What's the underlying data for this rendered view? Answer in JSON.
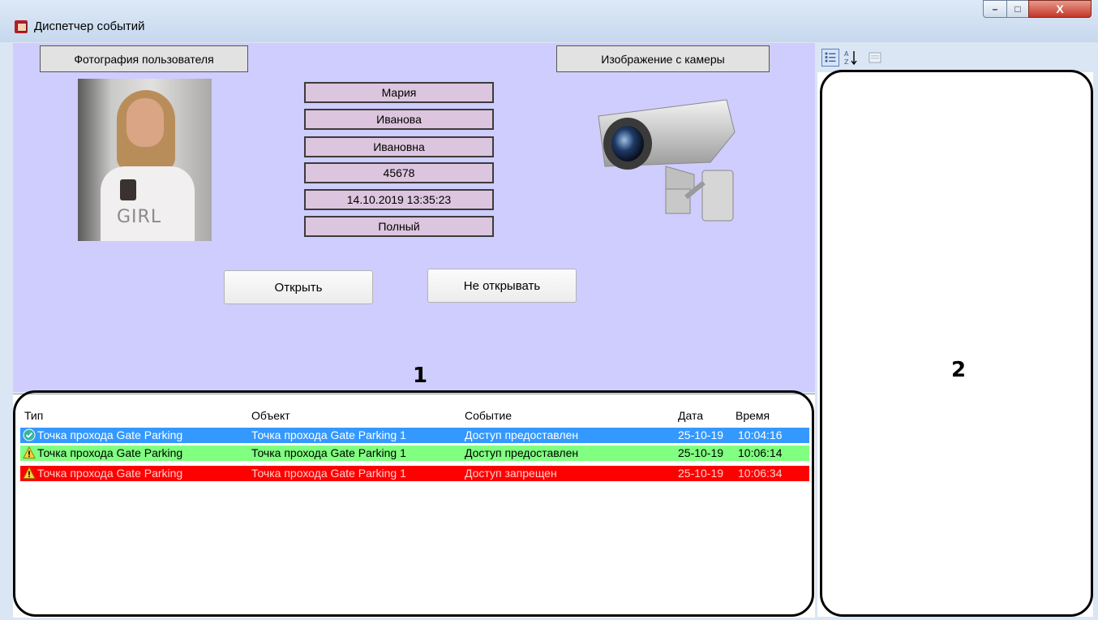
{
  "window": {
    "title": "Диспетчер событий",
    "buttons": {
      "minimize": "–",
      "maximize": "□",
      "close": "X"
    }
  },
  "panel": {
    "user_photo_label": "Фотография пользователя",
    "camera_label": "Изображение с камеры",
    "photo_caption": "GIRL",
    "fields": [
      "Мария",
      "Иванова",
      "Ивановна",
      "45678",
      "14.10.2019 13:35:23",
      "Полный"
    ],
    "open_button": "Открыть",
    "deny_button": "Не открывать"
  },
  "callouts": {
    "left": "1",
    "right": "2"
  },
  "events": {
    "columns": [
      "Тип",
      "Объект",
      "Событие",
      "Дата",
      "Время"
    ],
    "rows": [
      {
        "type": "Точка прохода Gate Parking",
        "object": "Точка прохода Gate Parking 1",
        "event": "Доступ предоставлен",
        "date": "25-10-19",
        "time": "10:04:16",
        "status_icon": "check-icon",
        "color": "#3399ff"
      },
      {
        "type": "Точка прохода Gate Parking",
        "object": "Точка прохода Gate Parking 1",
        "event": "Доступ предоставлен",
        "date": "25-10-19",
        "time": "10:06:14",
        "status_icon": "warning-icon",
        "color": "#80ff80"
      },
      {
        "type": "Точка прохода Gate Parking",
        "object": "Точка прохода Gate Parking 1",
        "event": "Доступ запрещен",
        "date": "25-10-19",
        "time": "10:06:34",
        "status_icon": "warning-icon",
        "color": "#ff0000"
      }
    ]
  },
  "toolbar": {
    "items": [
      "categorized-view-icon",
      "alphabetical-sort-icon",
      "property-pages-icon"
    ]
  },
  "colors": {
    "panel_bg": "#cfcdfd",
    "field_bg": "#dcc5de",
    "selected_row": "#3399ff",
    "granted_row": "#80ff80",
    "denied_row": "#ff0000"
  }
}
